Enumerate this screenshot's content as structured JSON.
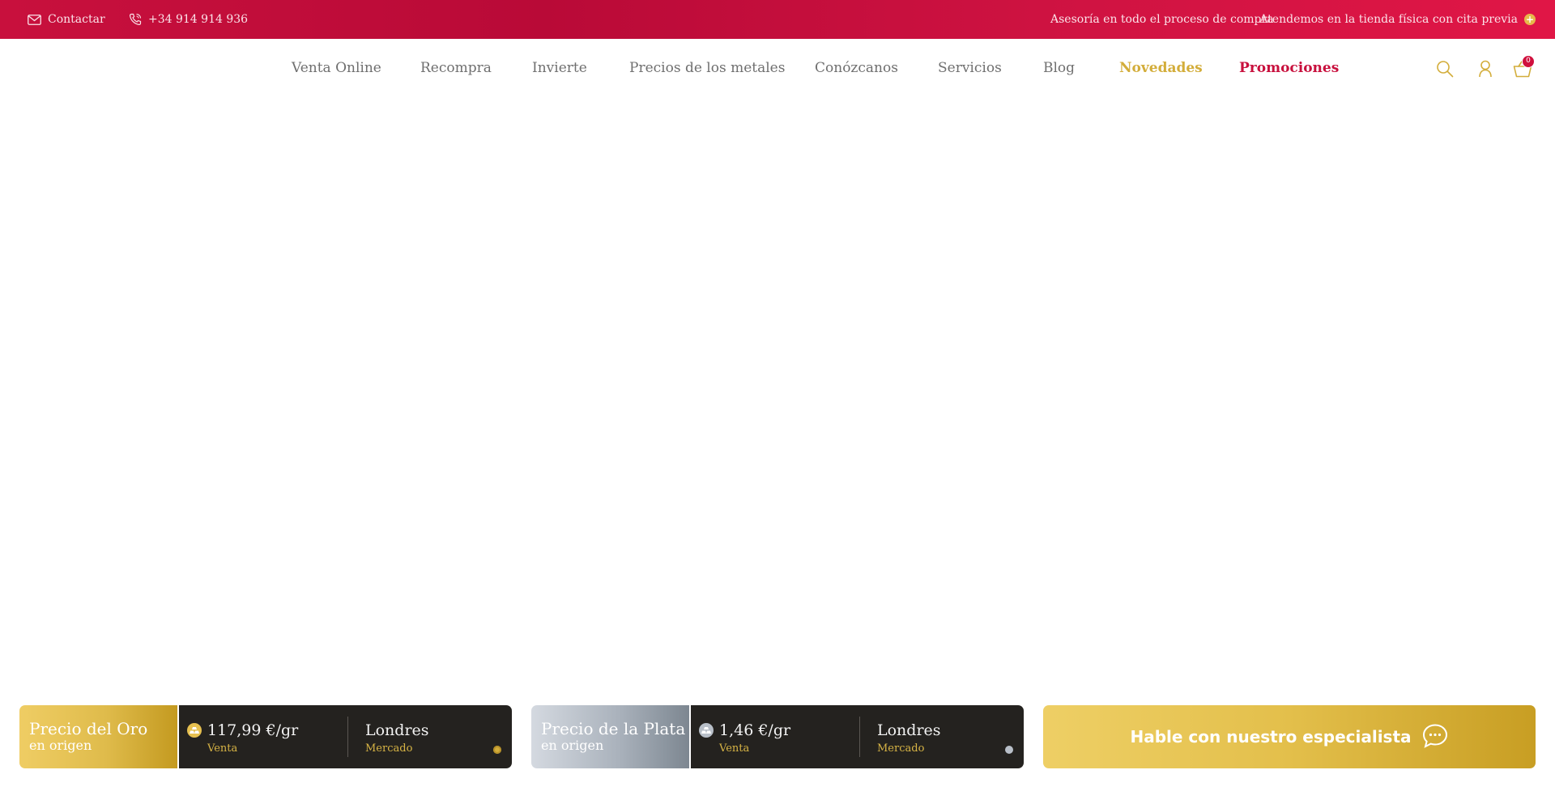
{
  "topbar": {
    "contact_label": "Contactar",
    "phone": "+34 914 914 936",
    "advice": "Asesoría en todo el proceso de compra",
    "store": "Atendemos en la tienda física con cita previa"
  },
  "nav": {
    "items": [
      {
        "label": "Venta Online"
      },
      {
        "label": "Recompra"
      },
      {
        "label": "Invierte"
      },
      {
        "label": "Precios de los metales"
      },
      {
        "label": "Conózcanos"
      },
      {
        "label": "Servicios"
      },
      {
        "label": "Blog"
      },
      {
        "label": "Novedades"
      },
      {
        "label": "Promociones"
      }
    ],
    "cart_count": "0"
  },
  "prices": {
    "gold": {
      "title": "Precio del Oro",
      "subtitle": "en origen",
      "price": "117,99 €/gr",
      "price_caption": "Venta",
      "market": "Londres",
      "market_caption": "Mercado"
    },
    "silver": {
      "title": "Precio de la Plata",
      "subtitle": "en origen",
      "price": "1,46 €/gr",
      "price_caption": "Venta",
      "market": "Londres",
      "market_caption": "Mercado"
    }
  },
  "cta": {
    "label": "Hable con nuestro especialista"
  },
  "colors": {
    "brand_red": "#c8103d",
    "brand_gold": "#d3ad3a",
    "dark_panel": "#24221f"
  }
}
